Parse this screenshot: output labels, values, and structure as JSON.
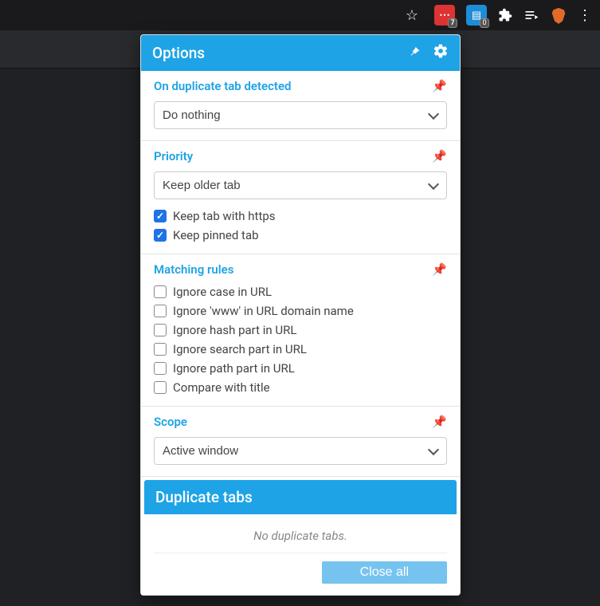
{
  "toolbar": {
    "ext_red_badge": "7",
    "ext_blue_badge": "0"
  },
  "options_panel": {
    "title": "Options"
  },
  "on_duplicate": {
    "title": "On duplicate tab detected",
    "select_value": "Do nothing"
  },
  "priority": {
    "title": "Priority",
    "select_value": "Keep older tab",
    "keep_https_label": "Keep tab with https",
    "keep_https_checked": true,
    "keep_pinned_label": "Keep pinned tab",
    "keep_pinned_checked": true
  },
  "matching_rules": {
    "title": "Matching rules",
    "rules": [
      {
        "label": "Ignore case in URL",
        "checked": false
      },
      {
        "label": "Ignore 'www' in URL domain name",
        "checked": false
      },
      {
        "label": "Ignore hash part in URL",
        "checked": false
      },
      {
        "label": "Ignore search part in URL",
        "checked": false
      },
      {
        "label": "Ignore path part in URL",
        "checked": false
      },
      {
        "label": "Compare with title",
        "checked": false
      }
    ]
  },
  "scope": {
    "title": "Scope",
    "select_value": "Active window"
  },
  "duplicate_tabs": {
    "title": "Duplicate tabs",
    "empty_msg": "No duplicate tabs.",
    "close_all_label": "Close all"
  }
}
